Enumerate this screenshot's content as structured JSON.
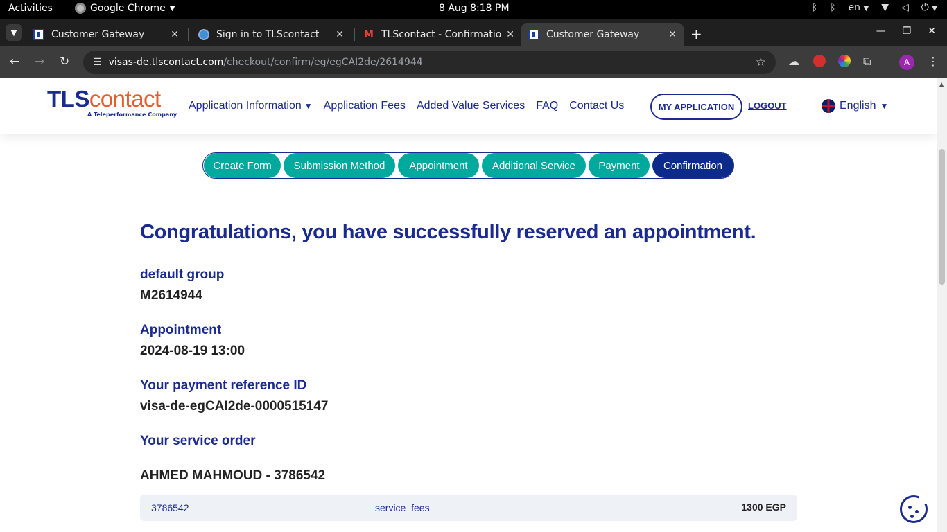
{
  "system_bar": {
    "activities": "Activities",
    "app_name": "Google Chrome",
    "clock": "8 Aug   8:18 PM",
    "keyboard_layout": "en"
  },
  "tabs": [
    {
      "title": "Customer Gateway",
      "icon": "tls-favicon-icon",
      "active": false
    },
    {
      "title": "Sign in to TLScontact",
      "icon": "globe-favicon-icon",
      "active": false
    },
    {
      "title": "TLScontact - Confirmation",
      "icon": "gmail-favicon-icon",
      "active": false
    },
    {
      "title": "Customer Gateway",
      "icon": "tls-favicon-icon",
      "active": true
    }
  ],
  "toolbar": {
    "url_host": "visas-de.tlscontact.com",
    "url_path": "/checkout/confirm/eg/egCAI2de/2614944",
    "avatar_letter": "A"
  },
  "site": {
    "logo_tls": "TLS",
    "logo_contact": "contact",
    "logo_tagline": "A Teleperformance Company",
    "nav": [
      {
        "label": "Application Information",
        "has_dropdown": true
      },
      {
        "label": "Application Fees"
      },
      {
        "label": "Added Value Services"
      },
      {
        "label": "FAQ"
      },
      {
        "label": "Contact Us"
      }
    ],
    "my_application": "MY APPLICATION",
    "logout": "LOGOUT",
    "language": "English"
  },
  "steps": [
    {
      "label": "Create Form",
      "state": "done"
    },
    {
      "label": "Submission Method",
      "state": "done"
    },
    {
      "label": "Appointment",
      "state": "done"
    },
    {
      "label": "Additional Service",
      "state": "done"
    },
    {
      "label": "Payment",
      "state": "done"
    },
    {
      "label": "Confirmation",
      "state": "current"
    }
  ],
  "confirmation": {
    "headline": "Congratulations, you have successfully reserved an appointment.",
    "group_label": "default group",
    "group_value": "M2614944",
    "appointment_label": "Appointment",
    "appointment_value": "2024-08-19 13:00",
    "payment_ref_label": "Your payment reference ID",
    "payment_ref_value": "visa-de-egCAI2de-0000515147",
    "service_order_label": "Your service order",
    "applicant": "AHMED MAHMOUD - 3786542",
    "order_rows": [
      {
        "id": "3786542",
        "service": "service_fees",
        "amount": "1300 EGP"
      }
    ]
  },
  "colors": {
    "brand_navy": "#1b2a8f",
    "brand_orange": "#e65c2b",
    "step_done": "#00a99d",
    "step_current": "#0c2a8a"
  }
}
